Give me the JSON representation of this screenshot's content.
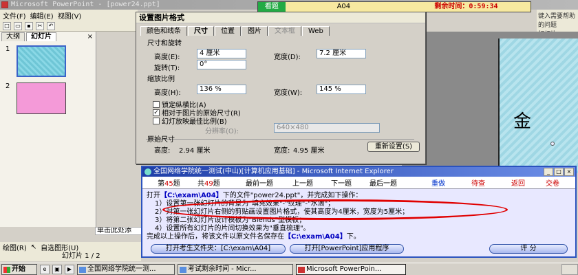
{
  "powerpoint": {
    "title": "Microsoft PowerPoint - [power24.ppt]",
    "menu": [
      "文件(F)",
      "编辑(E)",
      "视图(V)"
    ],
    "pane_tabs": [
      "大纲",
      "幻灯片"
    ],
    "pane_close": "×",
    "slide_numbers": [
      "1",
      "2"
    ],
    "slide_glyph": "金",
    "notes_text": "单击此处添",
    "draw_label": "绘图(R)",
    "autoshape_label": "自选图形(U)",
    "status": "幻灯片 1 / 2",
    "right_hint": "键入需要帮助的问题",
    "right_label": "幻灯片"
  },
  "banner": {
    "tab": "看题",
    "path": "A04",
    "timer": "剩余时间：0:59:34"
  },
  "dialog": {
    "title": "设置图片格式",
    "tabs": [
      "颜色和线条",
      "尺寸",
      "位置",
      "图片",
      "文本框",
      "Web"
    ],
    "size_section": "尺寸和旋转",
    "height_label": "高度(E):",
    "height_value": "4 厘米",
    "width_label": "宽度(D):",
    "width_value": "7.2 厘米",
    "rotate_label": "旋转(T):",
    "rotate_value": "0°",
    "scale_section": "缩放比例",
    "scale_height_label": "高度(H):",
    "scale_height_value": "136 %",
    "scale_width_label": "宽度(W):",
    "scale_width_value": "145 %",
    "lock_label": "锁定纵横比(A)",
    "relative_label": "相对于图片的原始尺寸(R)",
    "slideshow_label": "幻灯放映最佳比例(B)",
    "resolution_label": "分辨率(O):",
    "resolution_value": "640×480",
    "original_section": "原始尺寸",
    "orig_height_label": "高度:",
    "orig_height_value": "2.94 厘米",
    "orig_width_label": "宽度:",
    "orig_width_value": "4.95 厘米",
    "reset_button": "重新设置(S)"
  },
  "question_window": {
    "title": "全国网络学院统一测试(中山)[计算机应用基础] - Microsoft Internet Explorer",
    "question_number_prefix": "第",
    "question_number": "45",
    "question_number_suffix": "题",
    "total_prefix": "共",
    "total": "49",
    "total_suffix": "题",
    "nav": [
      "最前一题",
      "上一题",
      "下一题",
      "最后一题",
      "重做",
      "待查",
      "返回",
      "交卷"
    ],
    "intro_prefix": "打开",
    "intro_path": "【C:\\exam\\A04】",
    "intro_suffix": "下的文件\"power24.ppt\"，并完成如下操作：",
    "steps": [
      "1）设置第一张幻灯片的背景为\"填充效果\"-\"纹理\"-\"水滴\"；",
      "2）对第一张幻灯片右侧的剪贴画设置图片格式，使其高度为4厘米，宽度为5厘米；",
      "3）将第二张幻灯片设计模板为\"Blends\"型模板；",
      "4）设置所有幻灯片的片间切换效果为\"垂直梳理\"。"
    ],
    "save_prefix": "完成以上操作后，将该文件以原文件名保存在",
    "save_path": "【C:\\exam\\A04】",
    "save_suffix": "下。",
    "open_folder_button": "打开考生文件夹：[C:\\exam\\A04]",
    "open_app_button": "打开[PowerPoint]应用程序",
    "grade_button": "评  分"
  },
  "taskbar": {
    "start": "开始",
    "tasks": [
      "全国网络学院统一测...",
      "考试剩余时间 - Micr...",
      "Microsoft PowerPoin..."
    ]
  }
}
